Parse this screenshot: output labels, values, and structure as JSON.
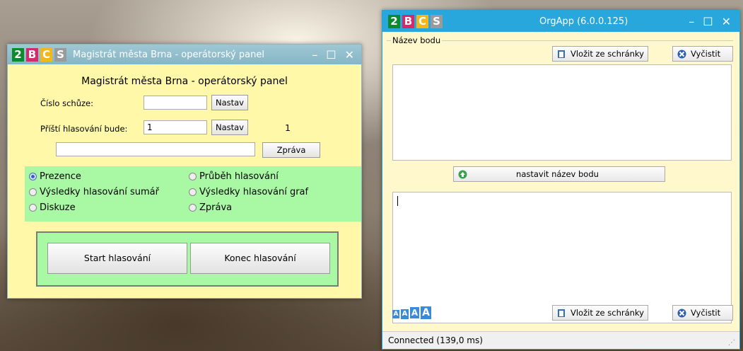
{
  "left_window": {
    "title": "Magistrát města Brna - operátorský panel",
    "heading": "Magistrát města Brna - operátorský panel",
    "badges": [
      "2",
      "B",
      "C",
      "S"
    ],
    "controls": {
      "minimize": "–",
      "maximize": "☐",
      "close": "✕"
    },
    "meeting_label": "Číslo schůze:",
    "meeting_value": "",
    "next_vote_label": "Příští hlasování bude:",
    "next_vote_value": "1",
    "next_vote_display": "1",
    "set_label": "Nastav",
    "message_value": "",
    "message_button": "Zpráva",
    "radios": [
      {
        "label": "Prezence",
        "checked": true
      },
      {
        "label": "Průběh hlasování",
        "checked": false
      },
      {
        "label": "Výsledky hlasování sumář",
        "checked": false
      },
      {
        "label": "Výsledky hlasování graf",
        "checked": false
      },
      {
        "label": "Diskuze",
        "checked": false
      },
      {
        "label": "Zpráva",
        "checked": false
      }
    ],
    "start_button": "Start hlasování",
    "end_button": "Konec hlasování"
  },
  "right_window": {
    "title": "OrgApp (6.0.0.125)",
    "badges": [
      "2",
      "B",
      "C",
      "S"
    ],
    "controls": {
      "minimize": "–",
      "maximize": "☐",
      "close": "✕"
    },
    "group_label": "Název bodu",
    "paste_label": "Vložit ze schránky",
    "clear_label": "Vyčistit",
    "set_name_button": "nastavit název bodu",
    "font_sizes": [
      "A",
      "A",
      "A",
      "A"
    ],
    "status": "Connected (139,0 ms)"
  },
  "colors": {
    "left_panel": "#fff8a8",
    "green_panel": "#a9f9a4",
    "right_titlebar": "#27a7dc",
    "left_titlebar": "#8fbccb"
  }
}
